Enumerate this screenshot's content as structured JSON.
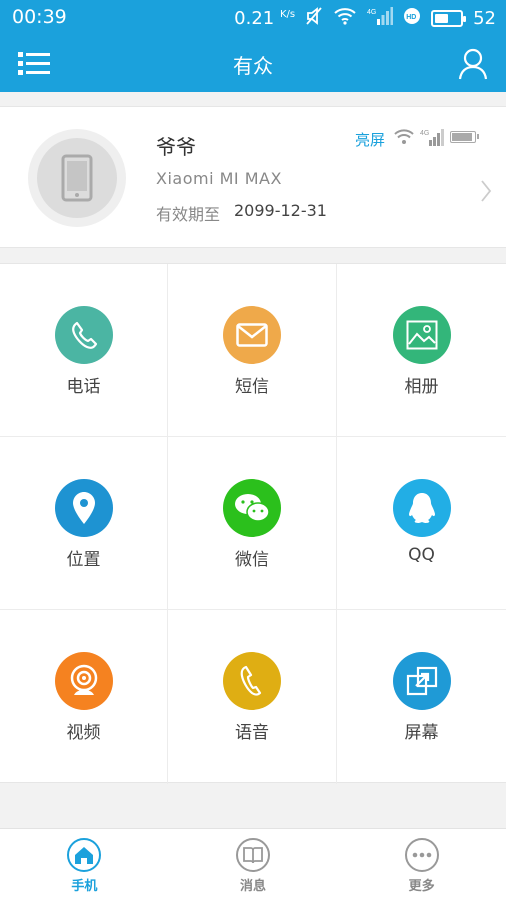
{
  "status_bar": {
    "time": "00:39",
    "speed_value": "0.21",
    "speed_unit": "K/s",
    "network_label": "4G",
    "battery_level": "52",
    "battery_fraction": 0.52
  },
  "header": {
    "title": "有众",
    "menu_icon": "list-icon",
    "user_icon": "user-icon",
    "color": "#1ba1dc"
  },
  "device": {
    "name": "爷爷",
    "model": "Xiaomi MI MAX",
    "expire_label": "有效期至",
    "expire_date": "2099-12-31",
    "screen_status": "亮屏",
    "network_label": "4G",
    "battery_fraction": 0.95
  },
  "features": [
    {
      "label": "电话",
      "icon": "phone-icon",
      "color": "#4bb5a3"
    },
    {
      "label": "短信",
      "icon": "envelope-icon",
      "color": "#efa94a"
    },
    {
      "label": "相册",
      "icon": "image-icon",
      "color": "#33b67a"
    },
    {
      "label": "位置",
      "icon": "location-pin-icon",
      "color": "#1e93d2"
    },
    {
      "label": "微信",
      "icon": "wechat-icon",
      "color": "#2bc01c"
    },
    {
      "label": "QQ",
      "icon": "qq-icon",
      "color": "#22aee5"
    },
    {
      "label": "视频",
      "icon": "webcam-icon",
      "color": "#f58220"
    },
    {
      "label": "语音",
      "icon": "handset-icon",
      "color": "#dfae13"
    },
    {
      "label": "屏幕",
      "icon": "screen-share-icon",
      "color": "#1f9ad6"
    }
  ],
  "bottom_nav": [
    {
      "label": "手机",
      "icon": "home-icon",
      "active": true
    },
    {
      "label": "消息",
      "icon": "book-icon",
      "active": false
    },
    {
      "label": "更多",
      "icon": "more-dots-icon",
      "active": false
    }
  ]
}
